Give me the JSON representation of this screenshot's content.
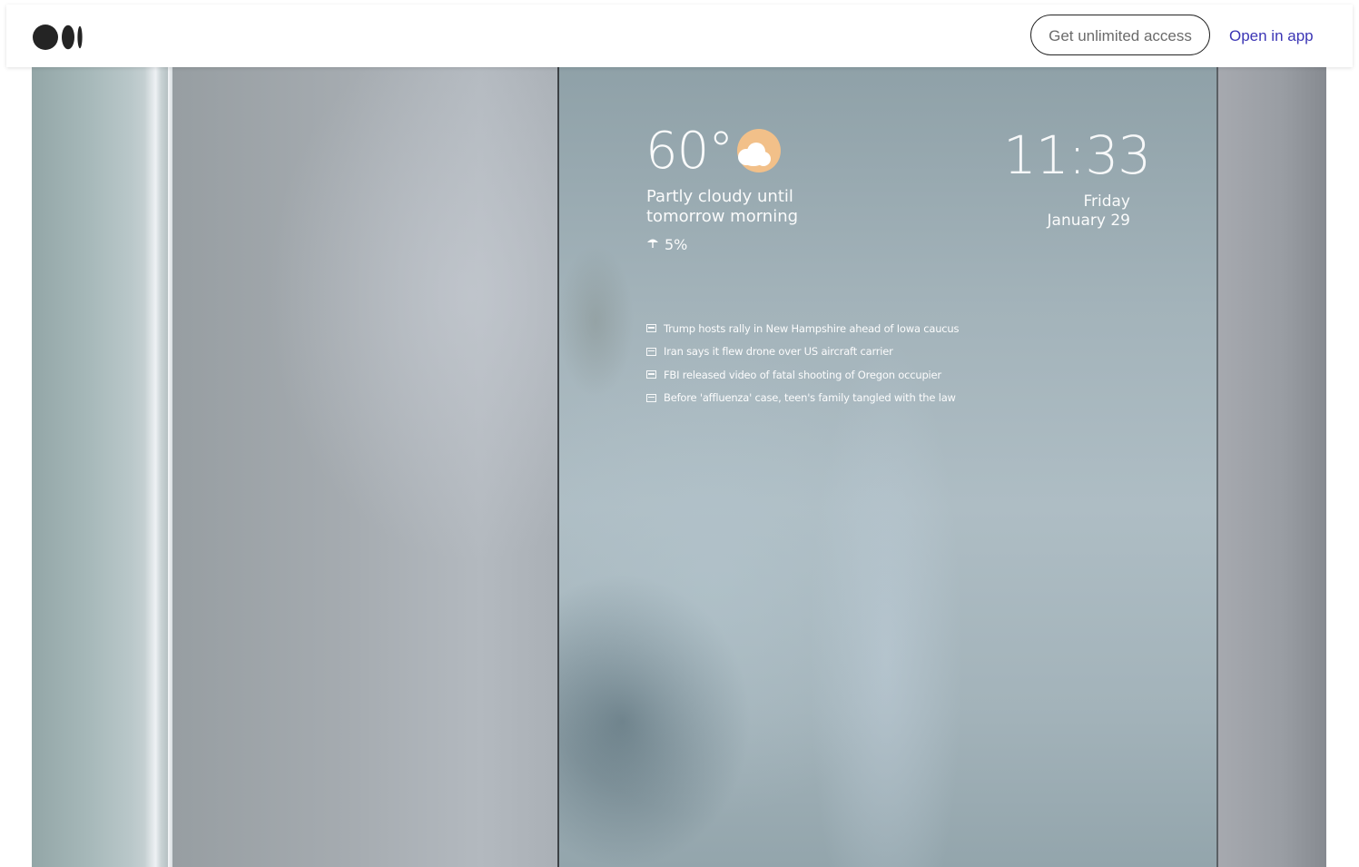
{
  "header": {
    "logo_icon": "medium-logo-icon",
    "cta_label": "Get unlimited access",
    "open_app_label": "Open in app"
  },
  "article_image": {
    "mirror": {
      "temperature": "60°",
      "weather_icon": "partly-cloudy-icon",
      "forecast": "Partly cloudy until tomorrow morning",
      "precip_icon": "umbrella-icon",
      "precipitation": "5%",
      "time": "11:33",
      "day": "Friday",
      "date": "January 29",
      "headlines": [
        "Trump hosts rally in New Hampshire ahead of Iowa caucus",
        "Iran says it flew drone over US aircraft carrier",
        "FBI released video of fatal shooting of Oregon occupier",
        "Before 'affluenza' case, teen's family tangled with the law"
      ]
    }
  }
}
